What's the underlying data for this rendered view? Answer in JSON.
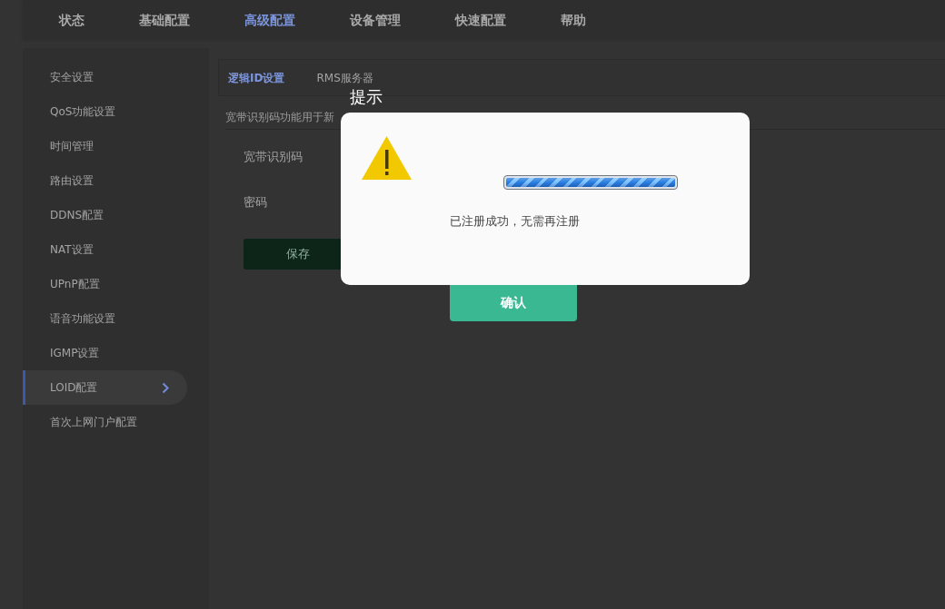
{
  "top_nav": {
    "items": [
      {
        "label": "状态",
        "selected": false
      },
      {
        "label": "基础配置",
        "selected": false
      },
      {
        "label": "高级配置",
        "selected": true
      },
      {
        "label": "设备管理",
        "selected": false
      },
      {
        "label": "快速配置",
        "selected": false
      },
      {
        "label": "帮助",
        "selected": false
      }
    ]
  },
  "sidebar": {
    "items": [
      {
        "label": "安全设置",
        "selected": false
      },
      {
        "label": "QoS功能设置",
        "selected": false
      },
      {
        "label": "时间管理",
        "selected": false
      },
      {
        "label": "路由设置",
        "selected": false
      },
      {
        "label": "DDNS配置",
        "selected": false
      },
      {
        "label": "NAT设置",
        "selected": false
      },
      {
        "label": "UPnP配置",
        "selected": false
      },
      {
        "label": "语音功能设置",
        "selected": false
      },
      {
        "label": "IGMP设置",
        "selected": false
      },
      {
        "label": "LOID配置",
        "selected": true
      },
      {
        "label": "首次上网门户配置",
        "selected": false
      }
    ]
  },
  "tabs": [
    {
      "label": "逻辑ID设置",
      "selected": true
    },
    {
      "label": "RMS服务器",
      "selected": false
    }
  ],
  "description": "宽带识别码功能用于新",
  "form": {
    "fields": [
      {
        "label": "宽带识别码"
      },
      {
        "label": "密码"
      }
    ],
    "save_button": "保存"
  },
  "dialog": {
    "title": "提示",
    "progress": {
      "level": 1
    },
    "message": "已注册成功，无需再注册",
    "confirm_button": "确认"
  }
}
